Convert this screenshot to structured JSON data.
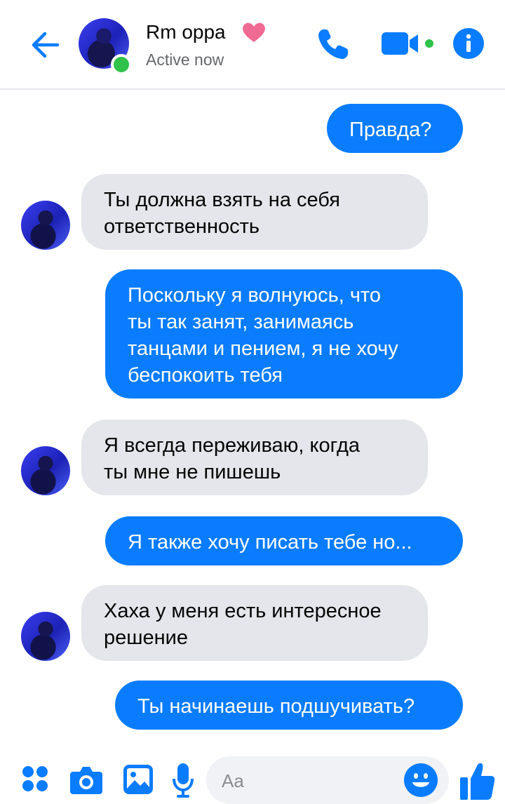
{
  "header": {
    "contact_name": "Rm oppa",
    "status": "Active now",
    "accent": "#0a7cff",
    "online_color": "#31c24a",
    "heart_color": "#f06b94"
  },
  "messages": [
    {
      "side": "out",
      "text": "Правда?"
    },
    {
      "side": "in",
      "text": "Ты должна взять на себя\nответственность"
    },
    {
      "side": "out",
      "text": "Поскольку я волнуюсь, что\nты так занят, занимаясь\nтанцами и пением, я не хочу\nбеспокоить тебя"
    },
    {
      "side": "in",
      "text": "Я всегда переживаю, когда\nты мне не пишешь"
    },
    {
      "side": "out",
      "text": "Я также хочу писать тебе но..."
    },
    {
      "side": "in",
      "text": "Хаха у меня есть интересное\nрешение"
    },
    {
      "side": "out",
      "text": "Ты начинаешь подшучивать?"
    }
  ],
  "composer": {
    "placeholder": "Aa",
    "icons": [
      "apps-icon",
      "camera-icon",
      "gallery-icon",
      "microphone-icon",
      "emoji-icon",
      "thumbs-up-icon"
    ]
  }
}
